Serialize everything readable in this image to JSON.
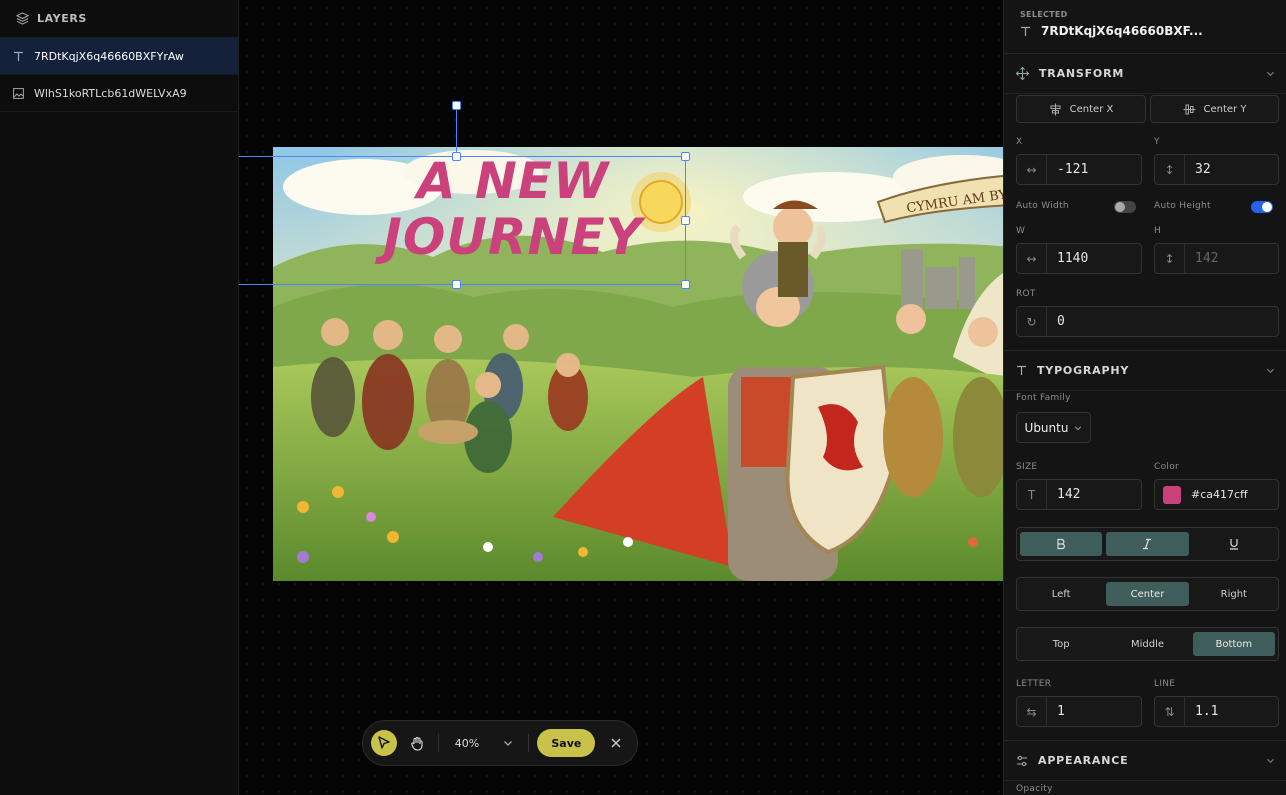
{
  "layers": {
    "title": "LAYERS",
    "items": [
      {
        "label": "7RDtKqjX6q46660BXFYrAw",
        "icon": "text-icon",
        "selected": true
      },
      {
        "label": "WlhS1koRTLcb61dWELVxA9",
        "icon": "image-icon",
        "selected": false
      }
    ]
  },
  "canvas": {
    "headline_line1": "A NEW",
    "headline_line2": "JOURNEY",
    "banner_text": "CYMRU AM BYTH"
  },
  "toolbar": {
    "zoom": "40%",
    "save_label": "Save"
  },
  "panel": {
    "selected_label": "SELECTED",
    "selected_name": "7RDtKqjX6q46660BXF...",
    "transform": {
      "title": "TRANSFORM",
      "center_x": "Center X",
      "center_y": "Center Y",
      "x_label": "X",
      "x_value": "-121",
      "y_label": "Y",
      "y_value": "32",
      "auto_width_label": "Auto Width",
      "auto_width": false,
      "auto_height_label": "Auto Height",
      "auto_height": true,
      "w_label": "W",
      "w_value": "1140",
      "h_label": "H",
      "h_value": "142",
      "rot_label": "ROT",
      "rot_value": "0"
    },
    "typography": {
      "title": "TYPOGRAPHY",
      "font_family_label": "Font Family",
      "font_family": "Ubuntu",
      "size_label": "SIZE",
      "size_value": "142",
      "color_label": "Color",
      "color_value": "#ca417cff",
      "color_swatch": "#ca417c",
      "align_options": [
        "Left",
        "Center",
        "Right"
      ],
      "align_selected": "Center",
      "valign_options": [
        "Top",
        "Middle",
        "Bottom"
      ],
      "valign_selected": "Bottom",
      "letter_label": "LETTER",
      "letter_value": "1",
      "line_label": "LINE",
      "line_value": "1.1"
    },
    "appearance": {
      "title": "APPEARANCE",
      "opacity_label": "Opacity"
    }
  },
  "colors": {
    "accent": "#c8c24a",
    "selection": "#4a86ff",
    "toggle_on": "#2563eb",
    "segment_on": "#3f5d5a"
  }
}
